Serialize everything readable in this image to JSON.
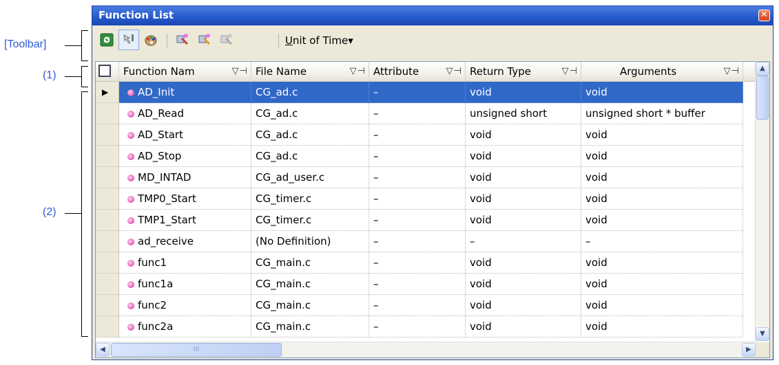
{
  "annotations": {
    "toolbar": "[Toolbar]",
    "header": "(1)",
    "list": "(2)"
  },
  "window": {
    "title": "Function List",
    "close_symbol": "✕"
  },
  "toolbar": {
    "unit_menu_label": "Unit of Time",
    "unit_menu_mnemonic": "U",
    "unit_menu_rest": "nit of Time",
    "dropdown_arrow": "▾"
  },
  "columns": [
    {
      "label": "Function Nam",
      "filter": "▽⊣"
    },
    {
      "label": "File Name",
      "filter": "▽⊣"
    },
    {
      "label": "Attribute",
      "filter": "▽⊣"
    },
    {
      "label": "Return Type",
      "filter": "▽⊣"
    },
    {
      "label": "Arguments",
      "filter": "▽⊣"
    }
  ],
  "rows": [
    {
      "name": "AD_Init",
      "file": "CG_ad.c",
      "attr": "–",
      "ret": "void",
      "args": "void",
      "selected": true
    },
    {
      "name": "AD_Read",
      "file": "CG_ad.c",
      "attr": "–",
      "ret": "unsigned short",
      "args": "unsigned short * buffer"
    },
    {
      "name": "AD_Start",
      "file": "CG_ad.c",
      "attr": "–",
      "ret": "void",
      "args": "void"
    },
    {
      "name": "AD_Stop",
      "file": "CG_ad.c",
      "attr": "–",
      "ret": "void",
      "args": "void"
    },
    {
      "name": "MD_INTAD",
      "file": "CG_ad_user.c",
      "attr": "–",
      "ret": "void",
      "args": "void"
    },
    {
      "name": "TMP0_Start",
      "file": "CG_timer.c",
      "attr": "–",
      "ret": "void",
      "args": "void"
    },
    {
      "name": "TMP1_Start",
      "file": "CG_timer.c",
      "attr": "–",
      "ret": "void",
      "args": "void"
    },
    {
      "name": "ad_receive",
      "file": "(No Definition)",
      "attr": "–",
      "ret": "–",
      "args": "–"
    },
    {
      "name": "func1",
      "file": "CG_main.c",
      "attr": "–",
      "ret": "void",
      "args": "void"
    },
    {
      "name": "func1a",
      "file": "CG_main.c",
      "attr": "–",
      "ret": "void",
      "args": "void"
    },
    {
      "name": "func2",
      "file": "CG_main.c",
      "attr": "–",
      "ret": "void",
      "args": "void"
    },
    {
      "name": "func2a",
      "file": "CG_main.c",
      "attr": "–",
      "ret": "void",
      "args": "void"
    }
  ],
  "icons": {
    "selected_row_marker": "▶",
    "scroll_up": "▲",
    "scroll_down": "▼",
    "scroll_left": "◀",
    "scroll_right": "▶",
    "thumb_grip": "III"
  },
  "colors": {
    "selection": "#3068c8",
    "title_bar": "#2458cc",
    "annotation": "#2a5bd7"
  }
}
